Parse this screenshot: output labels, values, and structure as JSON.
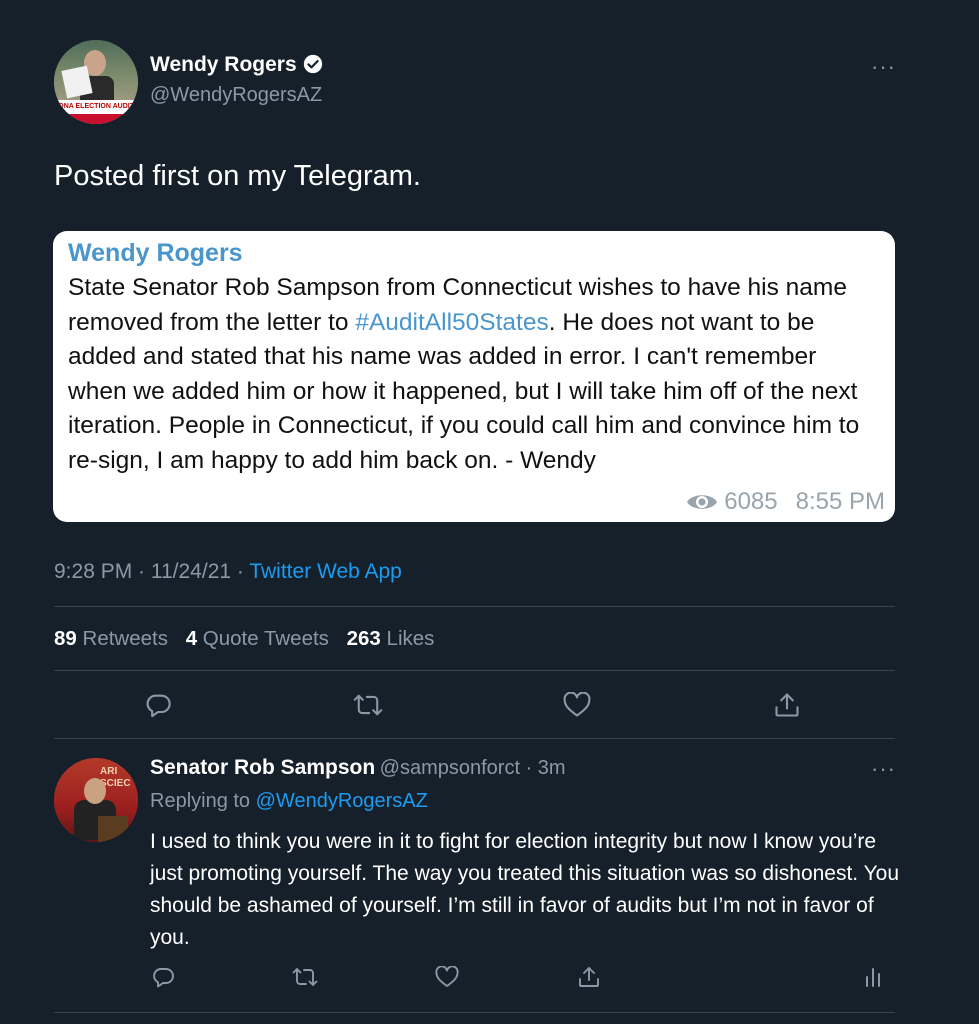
{
  "tweet": {
    "author_name": "Wendy Rogers",
    "author_handle": "@WendyRogersAZ",
    "avatar_sign_text": "ZONA ELECTION AUDIT RE",
    "text": "Posted first on my Telegram.",
    "more_label": "···",
    "timestamp": "9:28 PM · 11/24/21 · ",
    "source": "Twitter Web App",
    "stats": {
      "retweets_count": "89",
      "retweets_label": "Retweets",
      "quotes_count": "4",
      "quotes_label": "Quote Tweets",
      "likes_count": "263",
      "likes_label": "Likes"
    }
  },
  "telegram_card": {
    "author": "Wendy Rogers",
    "text_before": "State Senator Rob Sampson from Connecticut wishes to have his name removed from the letter to ",
    "hashtag": "#AuditAll50States",
    "text_after": ". He does not want to be added and stated that his name was added in error. I can't remember when we added him or how it happened, but I will take him off of the next iteration. People in Connecticut, if you could call him and convince him to re-sign, I am happy to add him back on. - Wendy",
    "views": "6085",
    "time": "8:55 PM"
  },
  "reply": {
    "author_name": "Senator Rob Sampson",
    "author_handle": "@sampsonforct",
    "time": " · 3m",
    "avatar_text": "ARI\nSCIEC",
    "replying_to_label": "Replying to ",
    "replying_to_handle": "@WendyRogersAZ",
    "text": "I used to think you were in it to fight for election integrity but now I know you’re just promoting yourself. The way you treated this situation was so dishonest. You should be ashamed of yourself. I’m still in favor of audits but I’m not in favor of you.",
    "more_label": "···"
  },
  "colors": {
    "background": "#15202b",
    "accent": "#1d9bf0",
    "secondary_text": "#8b98a5",
    "divider": "#38444d",
    "telegram_link": "#4a95cc"
  },
  "icons": {
    "reply": "reply-icon",
    "retweet": "retweet-icon",
    "like": "heart-icon",
    "share": "share-icon",
    "analytics": "analytics-icon",
    "verified": "verified-badge-icon",
    "views": "eye-icon"
  }
}
